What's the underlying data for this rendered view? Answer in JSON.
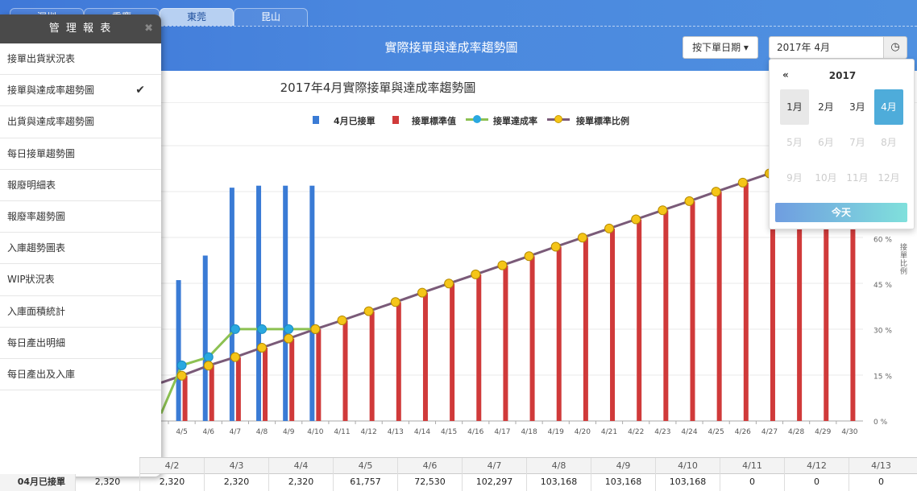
{
  "tabs": [
    {
      "label": "深圳",
      "active": false
    },
    {
      "label": "重慶",
      "active": false
    },
    {
      "label": "東莞",
      "active": true
    },
    {
      "label": "昆山",
      "active": false
    }
  ],
  "header": {
    "title": "實際接單與達成率趨勢圖",
    "sort_button": "按下單日期",
    "date_value": "2017年 4月",
    "clock_icon": "clock-icon"
  },
  "sidebar": {
    "title": "管 理 報 表",
    "close": "✖",
    "items": [
      {
        "label": "接單出貨狀況表",
        "selected": false
      },
      {
        "label": "接單與達成率趨勢圖",
        "selected": true
      },
      {
        "label": "出貨與達成率趨勢圖",
        "selected": false
      },
      {
        "label": "每日接單趨勢圖",
        "selected": false
      },
      {
        "label": "報廢明細表",
        "selected": false
      },
      {
        "label": "報廢率趨勢圖",
        "selected": false
      },
      {
        "label": "入庫趨勢圖表",
        "selected": false
      },
      {
        "label": "WIP狀況表",
        "selected": false
      },
      {
        "label": "入庫面積統計",
        "selected": false
      },
      {
        "label": "每日產出明細",
        "selected": false
      },
      {
        "label": "每日產出及入庫",
        "selected": false
      }
    ]
  },
  "datepicker": {
    "prev": "«",
    "year": "2017",
    "months": [
      "1月",
      "2月",
      "3月",
      "4月",
      "5月",
      "6月",
      "7月",
      "8月",
      "9月",
      "10月",
      "11月",
      "12月"
    ],
    "selected_month": "4月",
    "enabled_months": [
      "1月",
      "2月",
      "3月",
      "4月"
    ],
    "today_button": "今天"
  },
  "chart_data": {
    "type": "bar",
    "title": "2017年4月實際接單與達成率趨勢圖",
    "y2_label": "接單比例",
    "y2_ticks": [
      "0 %",
      "15 %",
      "30 %",
      "45 %",
      "60 %"
    ],
    "categories": [
      "4/5",
      "4/6",
      "4/7",
      "4/8",
      "4/9",
      "4/10",
      "4/11",
      "4/12",
      "4/13",
      "4/14",
      "4/15",
      "4/16",
      "4/17",
      "4/18",
      "4/19",
      "4/20",
      "4/21",
      "4/22",
      "4/23",
      "4/24",
      "4/25",
      "4/26",
      "4/27",
      "4/28",
      "4/29",
      "4/30"
    ],
    "legend": [
      "4月已接單",
      "接單標準值",
      "接單達成率",
      "接單標準比例"
    ],
    "colors": {
      "bar1": "#3a7bd5",
      "bar2": "#d03a3a",
      "line1": "#8cc152",
      "line2": "#7a5a78",
      "dot1": "#2aa8e0",
      "dot2": "#f5c518"
    },
    "series": [
      {
        "name": "4月已接單",
        "kind": "bar",
        "values": [
          61757,
          72530,
          102297,
          103168,
          103168,
          103168,
          0,
          0,
          0,
          0,
          0,
          0,
          0,
          0,
          0,
          0,
          0,
          0,
          0,
          0,
          0,
          0,
          0,
          0,
          0,
          0
        ]
      },
      {
        "name": "接單標準值",
        "kind": "bar",
        "values": [
          14.9,
          18.3,
          21.0,
          24.1,
          27.1,
          30.2,
          33.1,
          36.1,
          39.1,
          42.2,
          45.2,
          48.2,
          51.2,
          54.2,
          57.3,
          60.3,
          63.3,
          66.3,
          69.3,
          72.3,
          75.4,
          78.4,
          81.4,
          84.4,
          87.4,
          90.5
        ]
      },
      {
        "name": "接單達成率",
        "kind": "line",
        "values": [
          18.3,
          21.0,
          30.2,
          30.2,
          30.2,
          30.2
        ]
      },
      {
        "name": "接單標準比例",
        "kind": "line",
        "values": [
          14.9,
          18.2,
          21.0,
          24.1,
          27.1,
          30.2,
          33.1,
          36.1,
          39.1,
          42.2,
          45.2,
          48.2,
          51.2,
          54.2,
          57.3,
          60.3,
          63.3,
          66.3,
          69.3,
          72.3,
          75.4,
          78.4,
          81.4,
          84.4,
          87.4,
          90.5
        ]
      }
    ]
  },
  "table": {
    "row_label": "04月已接單",
    "first_value": "2,320",
    "headers": [
      "4/2",
      "4/3",
      "4/4",
      "4/5",
      "4/6",
      "4/7",
      "4/8",
      "4/9",
      "4/10",
      "4/11",
      "4/12",
      "4/13"
    ],
    "values": [
      "2,320",
      "2,320",
      "2,320",
      "61,757",
      "72,530",
      "102,297",
      "103,168",
      "103,168",
      "103,168",
      "0",
      "0",
      "0"
    ]
  }
}
